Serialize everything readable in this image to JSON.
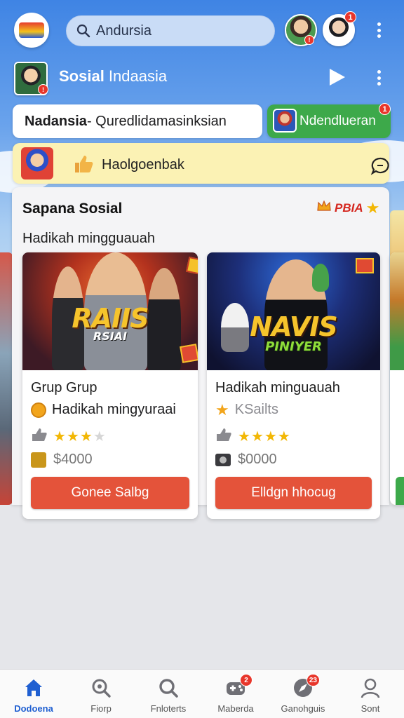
{
  "top_bar": {
    "search_value": "Andursia",
    "avatar_badges": [
      "!",
      "1"
    ]
  },
  "channel": {
    "title_bold": "Sosial",
    "title_rest": " Indaasia"
  },
  "pills": {
    "main_bold": "Nadansia",
    "main_rest": " - Quredlidamasinksian",
    "green_label": "Ndendlueran",
    "green_badge": "1"
  },
  "notice": {
    "text": "Haolgoenbak"
  },
  "section": {
    "title": "Sapana Sosial",
    "brand": "PBIA",
    "subtitle": "Hadikah mingguauah"
  },
  "games": [
    {
      "image_title": "RAIIS",
      "image_subtitle": "RSIAI",
      "name": "Grup Grup",
      "meta": "Hadikah mingyuraai",
      "rating": 3,
      "price": "$4000",
      "button": "Gonee Salbg"
    },
    {
      "image_title": "NAVIS",
      "image_subtitle": "PINIYER",
      "name": "Hadikah minguauah",
      "meta": "KSailts",
      "rating": 4,
      "price": "$0000",
      "button": "Elldgn hhocug"
    }
  ],
  "bottom_nav": [
    {
      "label": "Dodoena",
      "icon": "home-icon",
      "active": true
    },
    {
      "label": "Fiorp",
      "icon": "search-icon"
    },
    {
      "label": "Fnloterts",
      "icon": "search-icon"
    },
    {
      "label": "Maberda",
      "icon": "gamepad-icon",
      "badge": "2"
    },
    {
      "label": "Ganohguis",
      "icon": "compass-icon",
      "badge": "23"
    },
    {
      "label": "Sont",
      "icon": "profile-icon"
    }
  ],
  "colors": {
    "accent_blue": "#1f5fd1",
    "button_red": "#e4533a",
    "green": "#3da94a",
    "notice_yellow": "#fbf2b4",
    "badge_red": "#e8362b",
    "star_gold": "#f2b705"
  }
}
